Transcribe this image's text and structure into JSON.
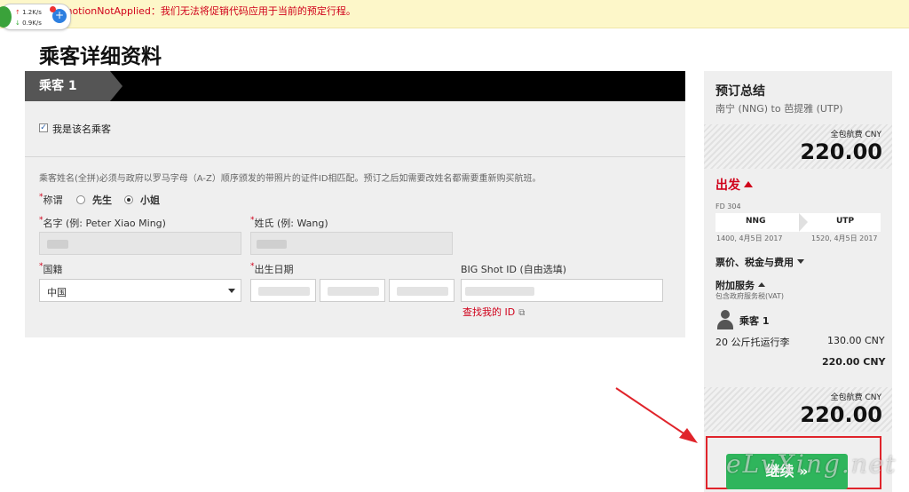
{
  "topbar": {
    "message": "omotionNotApplied：我们无法将促销代码应用于当前的预定行程。"
  },
  "netwidget": {
    "up_speed": "1.2K/s",
    "down_speed": "0.9K/s",
    "up_arrow": "↑",
    "down_arrow": "↓",
    "plus": "+"
  },
  "page": {
    "title": "乘客详细资料"
  },
  "passenger": {
    "tab_label": "乘客 1",
    "self_checkbox_label": "我是该名乘客",
    "self_checked": true,
    "note": "乘客姓名(全拼)必须与政府以罗马字母（A-Z）顺序颁发的带照片的证件ID相匹配。预订之后如需要改姓名都需要重新购买航班。",
    "title_label": "称谓",
    "title_options": [
      "先生",
      "小姐"
    ],
    "title_selected": "小姐",
    "first_name_label": "名字 (例: Peter Xiao Ming)",
    "last_name_label": "姓氏 (例: Wang)",
    "nationality_label": "国籍",
    "nationality_value": "中国",
    "dob_label": "出生日期",
    "bigshot_label": "BIG Shot ID (自由选填)",
    "find_id_link": "查找我的 ID",
    "required_mark": "*"
  },
  "summary": {
    "title": "预订总结",
    "route": "南宁 (NNG) to 芭提雅 (UTP)",
    "price_label": "全包航费 CNY",
    "price_value": "220.00",
    "departure_label": "出发",
    "flight_no": "FD 304",
    "from_code": "NNG",
    "to_code": "UTP",
    "dep_time": "1400, 4月5日 2017",
    "arr_time": "1520, 4月5日 2017",
    "fares_label": "票价、税金与费用",
    "addons_label": "附加服务",
    "vat_note": "包含政府服务税(VAT)",
    "pax_label": "乘客 1",
    "baggage_label": "20 公斤托运行李",
    "baggage_price": "130.00 CNY",
    "pax_total": "220.00 CNY"
  },
  "actions": {
    "continue_label": "继续 »"
  },
  "watermark": "eLvXing.net",
  "colors": {
    "brand_red": "#d0021b",
    "continue_green": "#2fb55c",
    "annotation_red": "#e0242b"
  }
}
